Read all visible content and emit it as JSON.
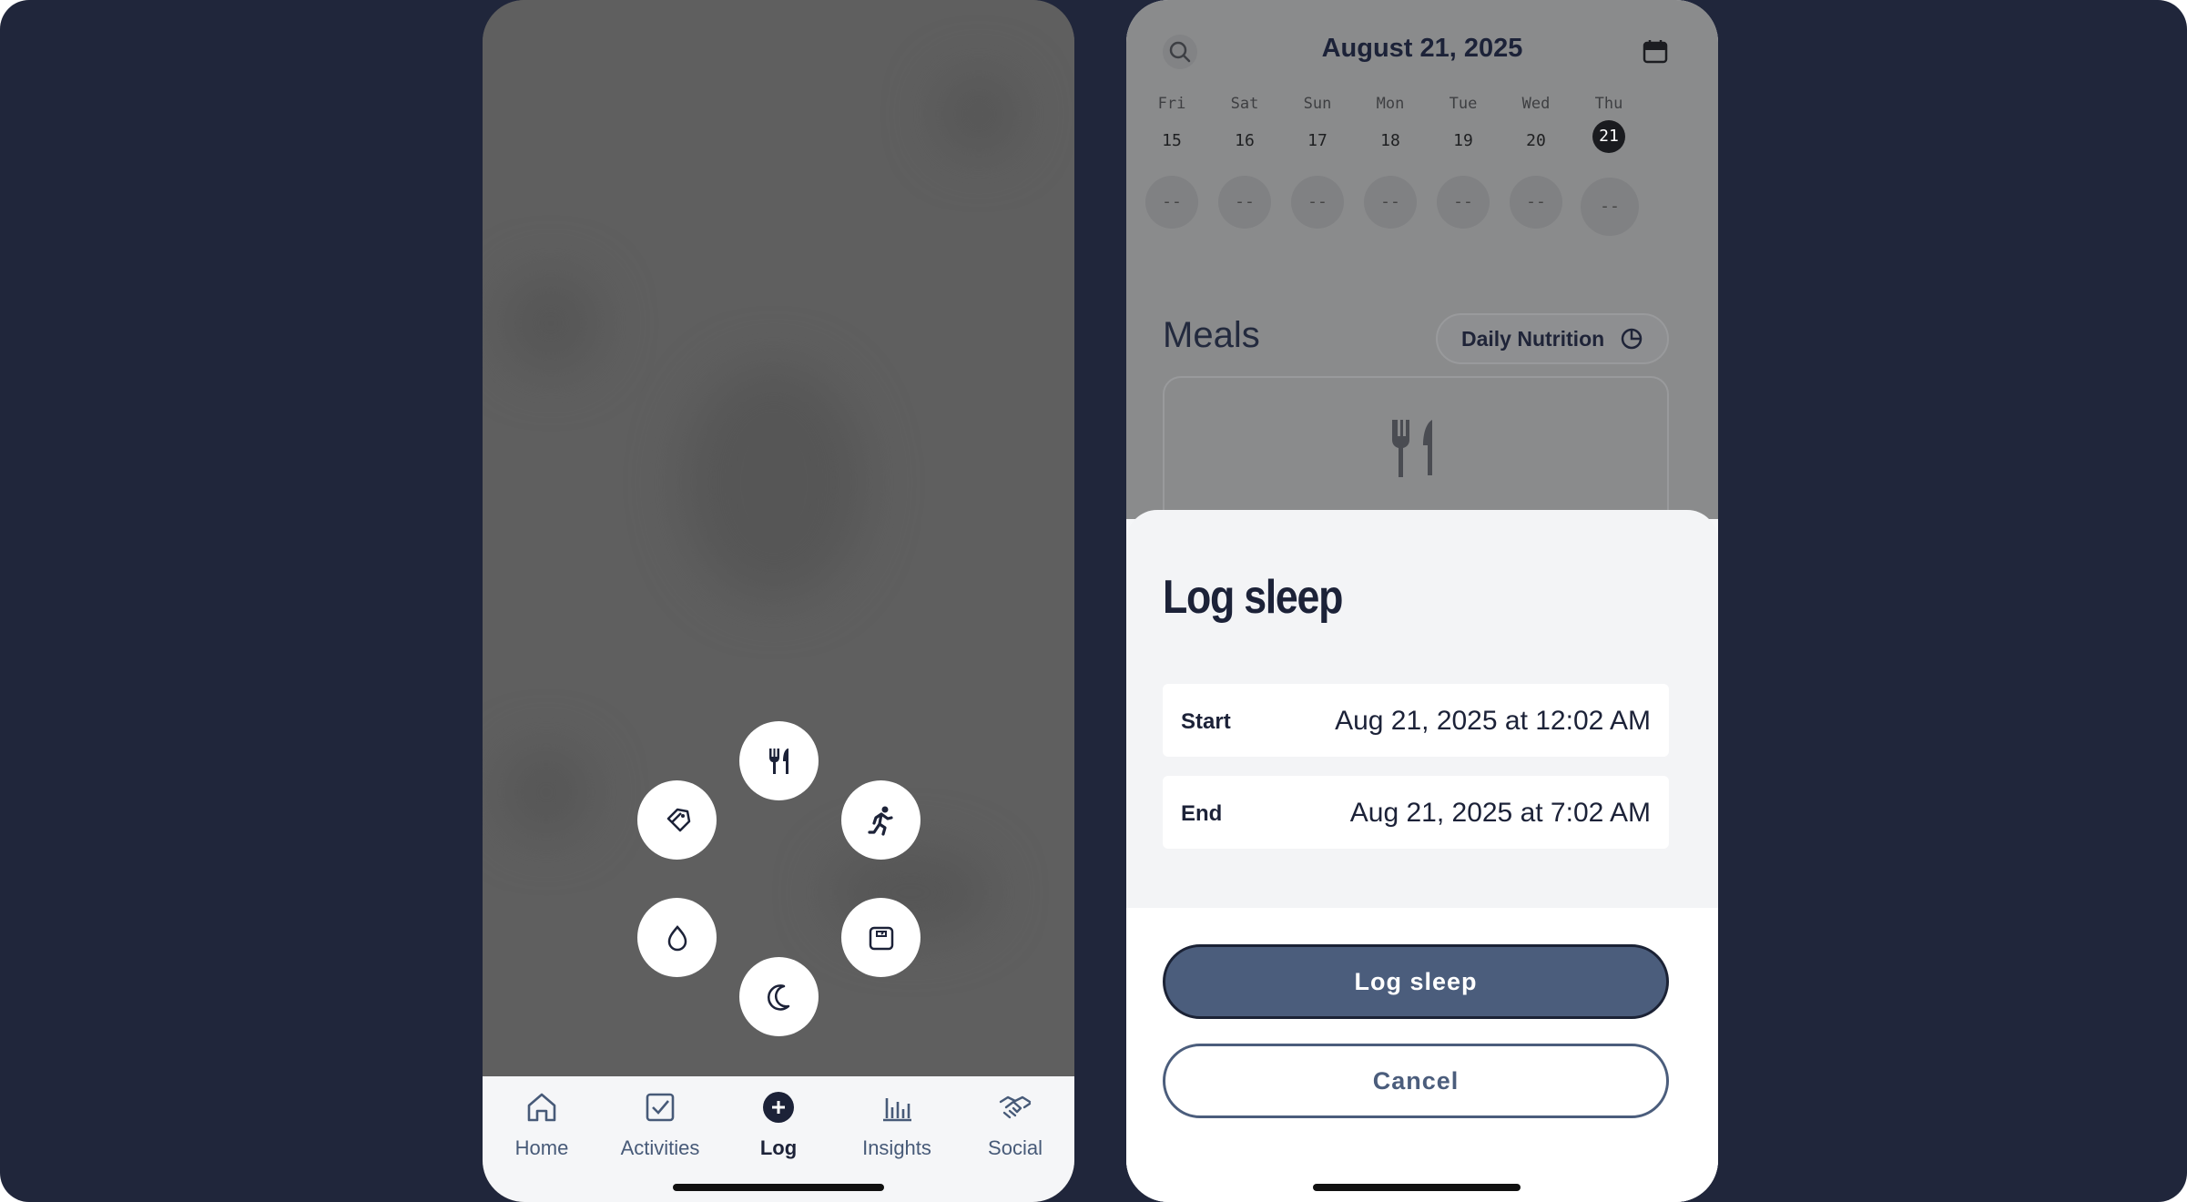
{
  "left_phone": {
    "quick_actions": [
      {
        "name": "log-meal-action",
        "icon": "fork-knife-icon"
      },
      {
        "name": "log-tag-action",
        "icon": "tag-icon"
      },
      {
        "name": "log-activity-action",
        "icon": "running-icon"
      },
      {
        "name": "log-water-action",
        "icon": "water-drop-icon"
      },
      {
        "name": "log-weight-action",
        "icon": "scale-icon"
      },
      {
        "name": "log-sleep-action",
        "icon": "moon-icon"
      }
    ],
    "tabbar": {
      "items": [
        {
          "label": "Home",
          "icon": "home-icon",
          "active": false
        },
        {
          "label": "Activities",
          "icon": "checkbox-icon",
          "active": false
        },
        {
          "label": "Log",
          "icon": "plus-circle-icon",
          "active": true
        },
        {
          "label": "Insights",
          "icon": "bar-chart-icon",
          "active": false
        },
        {
          "label": "Social",
          "icon": "handshake-icon",
          "active": false
        }
      ]
    }
  },
  "right_phone": {
    "header": {
      "date_title": "August 21, 2025",
      "search_icon": "search-icon",
      "calendar_icon": "calendar-icon"
    },
    "week": [
      {
        "day": "Fri",
        "num": "15",
        "value": "--"
      },
      {
        "day": "Sat",
        "num": "16",
        "value": "--"
      },
      {
        "day": "Sun",
        "num": "17",
        "value": "--"
      },
      {
        "day": "Mon",
        "num": "18",
        "value": "--"
      },
      {
        "day": "Tue",
        "num": "19",
        "value": "--"
      },
      {
        "day": "Wed",
        "num": "20",
        "value": "--"
      },
      {
        "day": "Thu",
        "num": "21",
        "value": "--",
        "selected": true
      }
    ],
    "meals": {
      "title": "Meals",
      "nutrition_button": "Daily Nutrition"
    },
    "sheet": {
      "title": "Log sleep",
      "start_label": "Start",
      "start_value": "Aug 21, 2025 at 12:02 AM",
      "end_label": "End",
      "end_value": "Aug 21, 2025 at 7:02 AM",
      "primary_button": "Log sleep",
      "secondary_button": "Cancel"
    }
  },
  "colors": {
    "background": "#20263b",
    "primary": "#4b5d7c",
    "text_dark": "#1c2238"
  }
}
